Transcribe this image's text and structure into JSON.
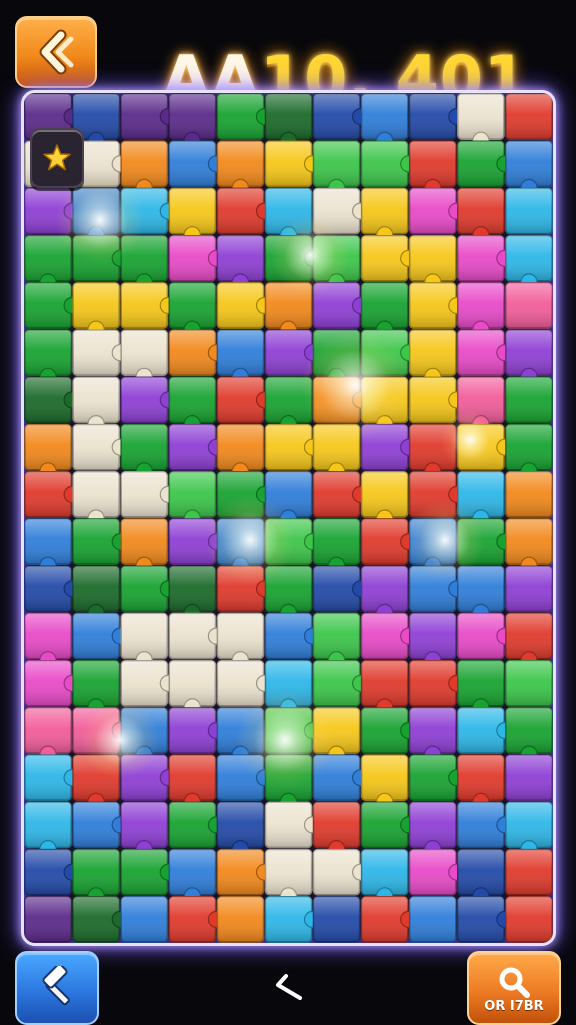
{
  "hud": {
    "score_prefix": "AA",
    "score_value": "10. 401"
  },
  "buttons": {
    "back_icon": "chevron-left-icon",
    "star_icon": "star-icon",
    "hammer_icon": "hammer-icon",
    "hint_icon": "magnifier-icon",
    "hint_label": "OR I7BR",
    "center_icon": "arrow-left-icon"
  },
  "puzzle": {
    "palette": {
      "W": "#ece3cf",
      "Y": "#f6c719",
      "O": "#f2891c",
      "R": "#e03a2c",
      "G": "#18a331",
      "L": "#3cc64a",
      "B": "#2f7ed9",
      "C": "#2db7e8",
      "P": "#8e3fd4",
      "M": "#e84ac8",
      "K": "#f25d9a",
      "N": "#234aa8",
      "D": "#1b6a2a",
      "V": "#5a2a8a"
    },
    "rows": [
      "VNVVGDNBNWR",
      "WWOBOYLLRGB",
      "PBCYRCWYMRC",
      "GGGMPGLYYMC",
      "GYYGYOPGYMK",
      "GWWOBPGLYMP",
      "DWPGRGOYYKG",
      "OWGPOYYPRYG",
      "RWWLGBRYRCO",
      "BGOPBLGRBGO",
      "NDGDRGNPBBP",
      "MBWWWBLMPMR",
      "MGWWWCLRRGL",
      "KKBPBLYGPCG",
      "CRPRBGBYGRP",
      "CBPGNWRGPBC",
      "NGGBOWWCMNR",
      "VDBROCNRBNR"
    ]
  }
}
